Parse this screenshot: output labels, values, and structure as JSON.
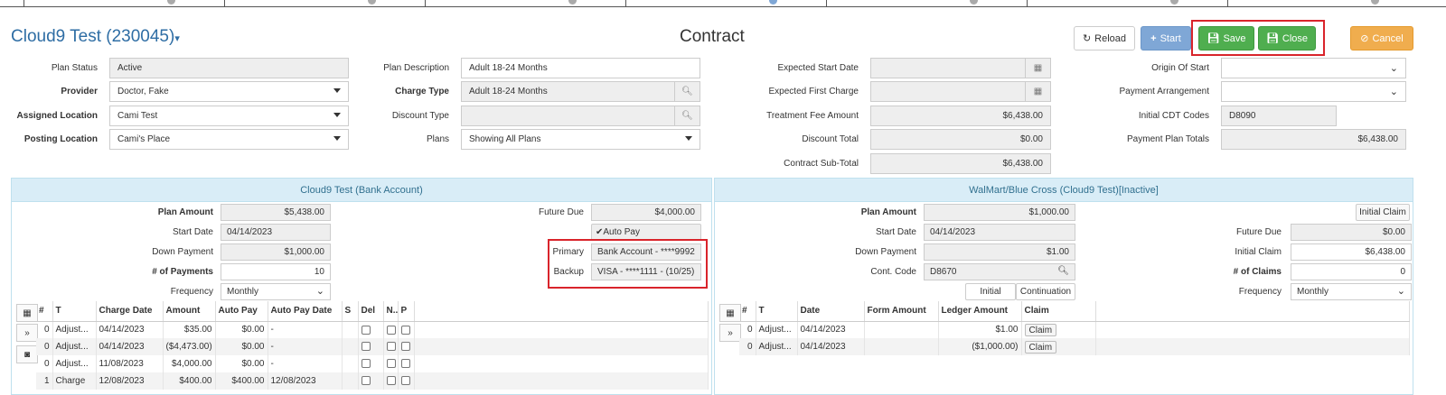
{
  "header": {
    "title": "Cloud9 Test (230045)",
    "center_title": "Contract",
    "buttons": {
      "reload": "Reload",
      "start": "Start",
      "save": "Save",
      "close": "Close",
      "cancel": "Cancel"
    }
  },
  "form": {
    "plan_status": {
      "label": "Plan Status",
      "value": "Active"
    },
    "provider": {
      "label": "Provider",
      "value": "Doctor, Fake"
    },
    "assigned_location": {
      "label": "Assigned Location",
      "value": "Cami Test"
    },
    "posting_location": {
      "label": "Posting Location",
      "value": "Cami's Place"
    },
    "plan_description": {
      "label": "Plan Description",
      "value": "Adult 18-24  Months"
    },
    "charge_type": {
      "label": "Charge Type",
      "value": "Adult 18-24  Months"
    },
    "discount_type": {
      "label": "Discount Type",
      "value": ""
    },
    "plans": {
      "label": "Plans",
      "value": "Showing All Plans"
    },
    "expected_start_date": {
      "label": "Expected Start Date",
      "value": ""
    },
    "expected_first_charge": {
      "label": "Expected First Charge",
      "value": ""
    },
    "treatment_fee_amount": {
      "label": "Treatment Fee Amount",
      "value": "$6,438.00"
    },
    "discount_total": {
      "label": "Discount Total",
      "value": "$0.00"
    },
    "contract_sub_total": {
      "label": "Contract Sub-Total",
      "value": "$6,438.00"
    },
    "origin_of_start": {
      "label": "Origin Of Start",
      "value": ""
    },
    "payment_arrangement": {
      "label": "Payment Arrangement",
      "value": ""
    },
    "initial_cdt_codes": {
      "label": "Initial CDT Codes",
      "value": "D8090"
    },
    "payment_plan_totals": {
      "label": "Payment Plan Totals",
      "value": "$6,438.00"
    }
  },
  "left_panel": {
    "title": "Cloud9 Test (Bank Account)",
    "plan_amount": {
      "label": "Plan Amount",
      "value": "$5,438.00"
    },
    "start_date": {
      "label": "Start Date",
      "value": "04/14/2023"
    },
    "down_payment": {
      "label": "Down Payment",
      "value": "$1,000.00"
    },
    "num_payments": {
      "label": "# of Payments",
      "value": "10"
    },
    "frequency": {
      "label": "Frequency",
      "value": "Monthly"
    },
    "future_due": {
      "label": "Future Due",
      "value": "$4,000.00"
    },
    "auto_pay": "Auto Pay",
    "primary": {
      "label": "Primary",
      "value": "Bank Account - ****9992"
    },
    "backup": {
      "label": "Backup",
      "value": "VISA - ****1111 - (10/25)"
    },
    "grid": {
      "columns": [
        "#",
        "T",
        "Charge Date",
        "Amount",
        "Auto Pay",
        "Auto Pay Date",
        "S",
        "Del",
        "N..",
        "P"
      ],
      "rows": [
        {
          "num": "0",
          "type": "Adjust...",
          "charge_date": "04/14/2023",
          "amount": "$35.00",
          "auto_pay": "$0.00",
          "auto_pay_date": "-"
        },
        {
          "num": "0",
          "type": "Adjust...",
          "charge_date": "04/14/2023",
          "amount": "($4,473.00)",
          "auto_pay": "$0.00",
          "auto_pay_date": "-"
        },
        {
          "num": "0",
          "type": "Adjust...",
          "charge_date": "11/08/2023",
          "amount": "$4,000.00",
          "auto_pay": "$0.00",
          "auto_pay_date": "-"
        },
        {
          "num": "1",
          "type": "Charge",
          "charge_date": "12/08/2023",
          "amount": "$400.00",
          "auto_pay": "$400.00",
          "auto_pay_date": "12/08/2023"
        }
      ]
    }
  },
  "right_panel": {
    "title": "WalMart/Blue Cross (Cloud9 Test)[Inactive]",
    "plan_amount": {
      "label": "Plan Amount",
      "value": "$1,000.00"
    },
    "start_date": {
      "label": "Start Date",
      "value": "04/14/2023"
    },
    "down_payment": {
      "label": "Down Payment",
      "value": "$1.00"
    },
    "cont_code": {
      "label": "Cont. Code",
      "value": "D8670"
    },
    "initial_btn": "Initial",
    "continuation_btn": "Continuation",
    "initial_claim_btn": "Initial Claim",
    "future_due": {
      "label": "Future Due",
      "value": "$0.00"
    },
    "initial_claim": {
      "label": "Initial Claim",
      "value": "$6,438.00"
    },
    "num_claims": {
      "label": "# of Claims",
      "value": "0"
    },
    "frequency": {
      "label": "Frequency",
      "value": "Monthly"
    },
    "grid": {
      "columns": [
        "#",
        "T",
        "Date",
        "Form Amount",
        "Ledger Amount",
        "Claim"
      ],
      "rows": [
        {
          "num": "0",
          "type": "Adjust...",
          "date": "04/14/2023",
          "form_amount": "",
          "ledger_amount": "$1.00",
          "claim": "Claim"
        },
        {
          "num": "0",
          "type": "Adjust...",
          "date": "04/14/2023",
          "form_amount": "",
          "ledger_amount": "($1,000.00)",
          "claim": "Claim"
        }
      ]
    }
  }
}
